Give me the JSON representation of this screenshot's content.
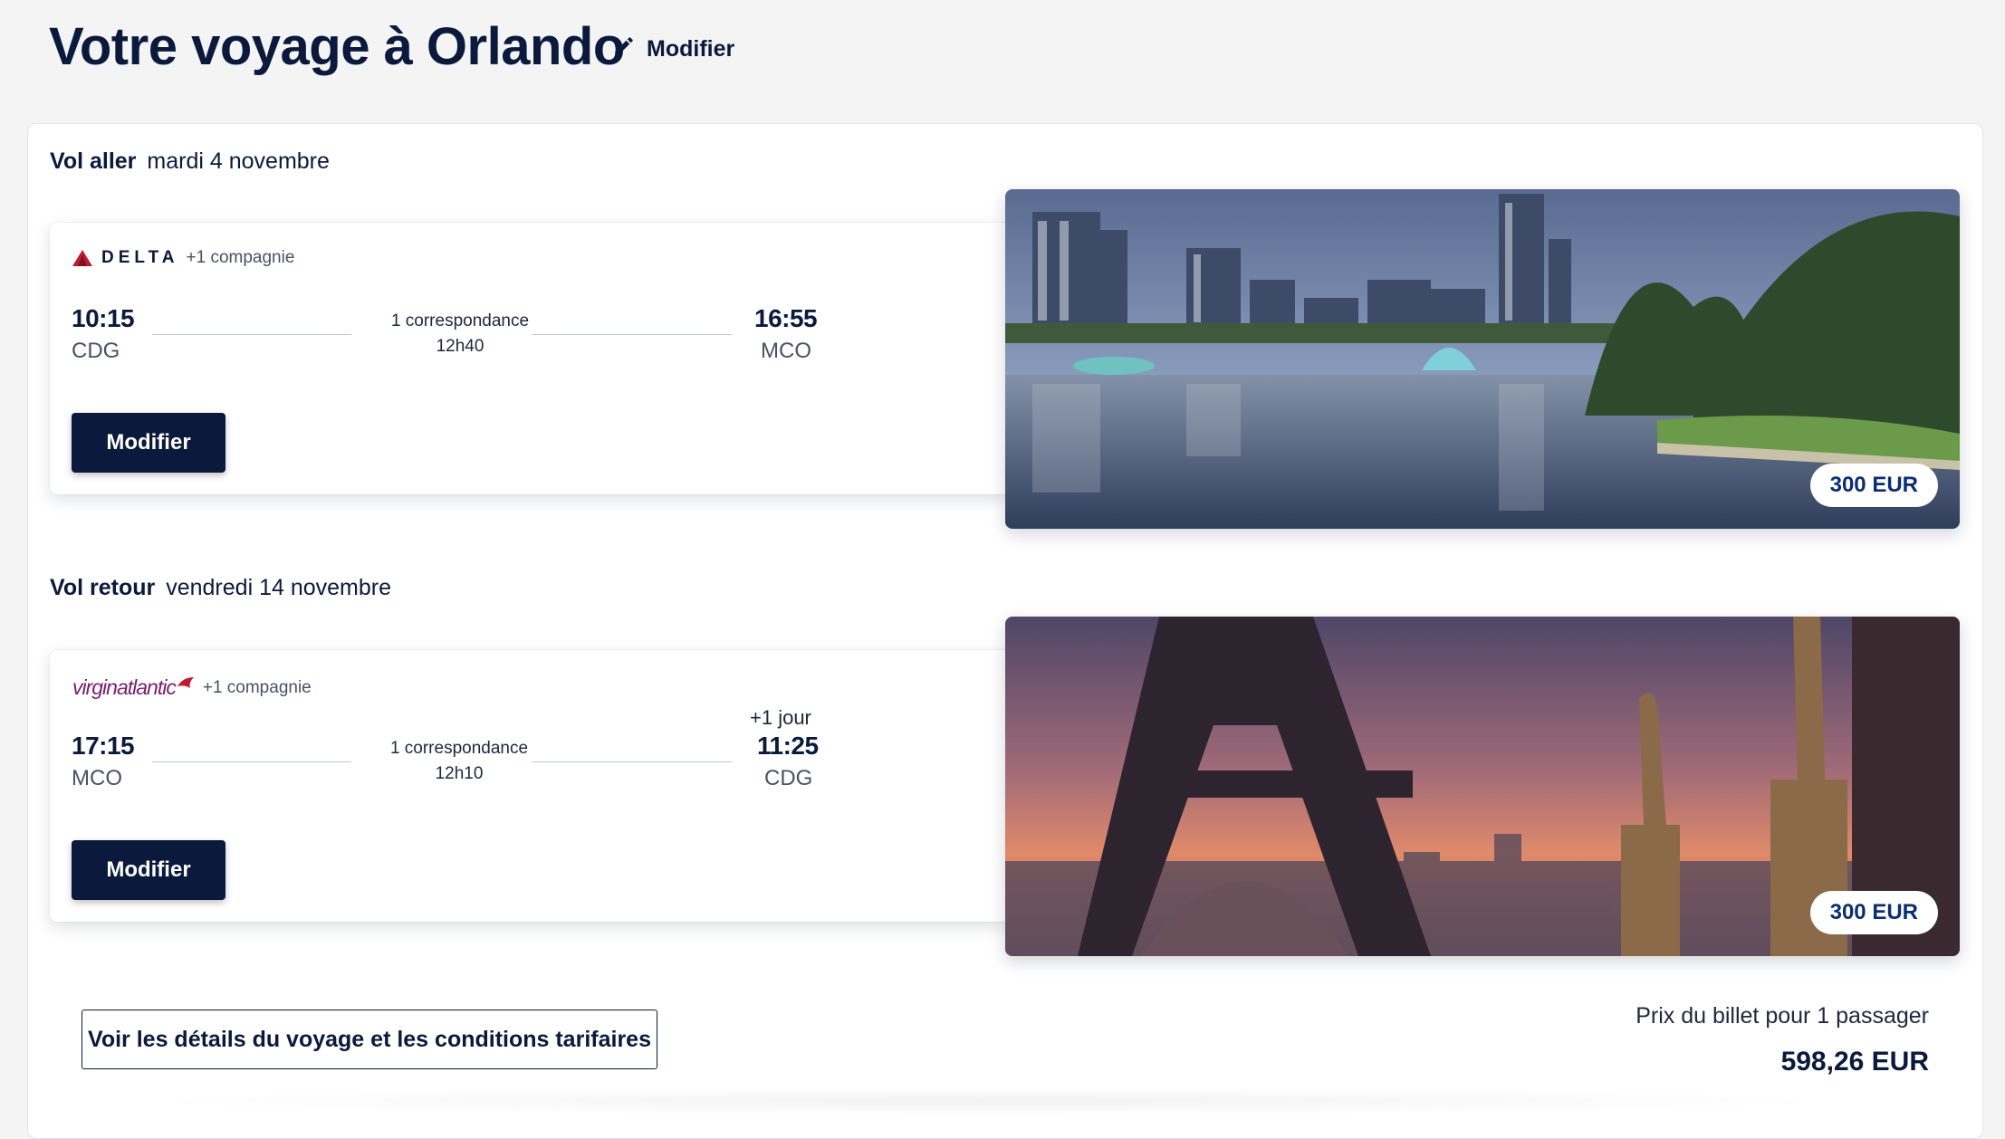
{
  "header": {
    "title": "Votre voyage à Orlando",
    "edit_label": "Modifier"
  },
  "outbound": {
    "label": "Vol aller",
    "date": "mardi 4 novembre",
    "airline": "DELTA",
    "extra_airline": "+1 compagnie",
    "departure_time": "10:15",
    "departure_airport": "CDG",
    "arrival_time": "16:55",
    "arrival_airport": "MCO",
    "connections": "1 correspondance",
    "duration": "12h40",
    "modify_label": "Modifier",
    "destination_image": "orlando-skyline-lake",
    "price": "300 EUR"
  },
  "return": {
    "label": "Vol retour",
    "date": "vendredi 14 novembre",
    "airline": "virginatlantic",
    "extra_airline": "+1 compagnie",
    "departure_time": "17:15",
    "departure_airport": "MCO",
    "arrival_day_offset": "+1 jour",
    "arrival_time": "11:25",
    "arrival_airport": "CDG",
    "connections": "1 correspondance",
    "duration": "12h10",
    "modify_label": "Modifier",
    "destination_image": "paris-eiffel-tower-sunset",
    "price": "300 EUR"
  },
  "footer": {
    "details_button": "Voir les détails du voyage et les conditions tarifaires",
    "price_caption": "Prix du billet pour 1 passager",
    "price_total": "598,26 EUR"
  },
  "colors": {
    "brand_navy": "#0b1a3c",
    "price_blue": "#0b2e73",
    "delta_red": "#c01933",
    "virgin_purple": "#7a1f6d"
  }
}
